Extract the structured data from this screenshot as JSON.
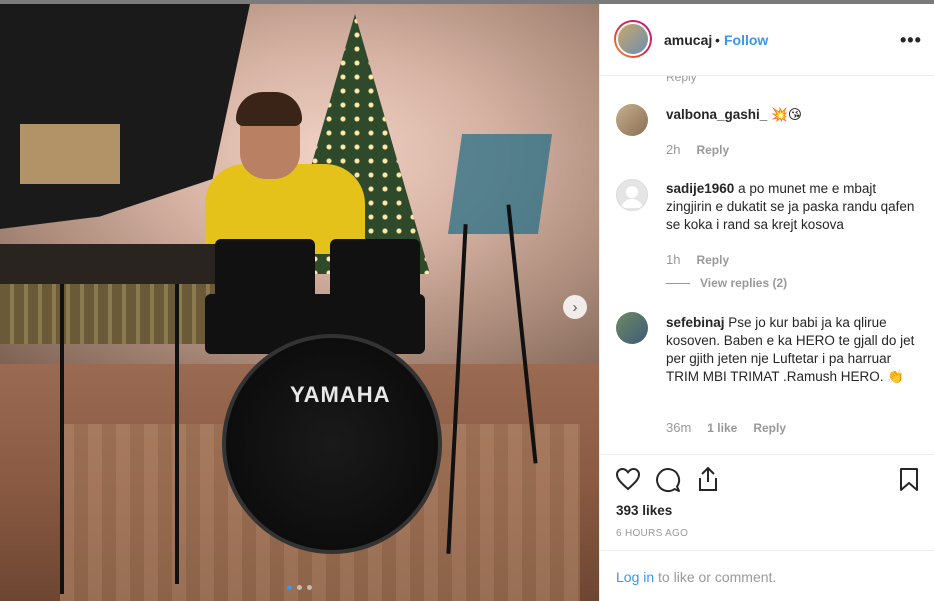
{
  "post": {
    "username": "amucaj",
    "separator": "•",
    "follow_label": "Follow",
    "more_label": "•••",
    "drum_brand": "YAMAHA",
    "next_arrow": "›",
    "carousel": {
      "count": 3,
      "active_index": 0
    }
  },
  "comments": [
    {
      "username": "valbona_gashi_",
      "text": " 💥😘",
      "time": "2h",
      "likes_label": "",
      "reply_label": "Reply"
    },
    {
      "username": "sadije1960",
      "text": " a po munet me e mbajt zingjirin e dukatit se ja paska randu qafen se koka i rand sa krejt kosova",
      "time": "1h",
      "likes_label": "",
      "reply_label": "Reply",
      "view_replies_label": "View replies (2)"
    },
    {
      "username": "sefebinaj",
      "text": " Pse jo kur babi ja ka qlirue kosoven. Baben e ka HERO te gjall do jet per gjith jeten nje Luftetar i pa harruar TRIM MBI TRIMAT .Ramush HERO. 👏",
      "time": "36m",
      "likes_label": "1 like",
      "reply_label": "Reply"
    }
  ],
  "cut_top_label": "Reply",
  "actions": {
    "like_icon": "heart-icon",
    "comment_icon": "comment-icon",
    "share_icon": "share-icon",
    "save_icon": "bookmark-icon",
    "likes_text": "393 likes",
    "time_ago": "6 HOURS AGO"
  },
  "login": {
    "link_text": "Log in",
    "rest_text": " to like or comment."
  },
  "colors": {
    "link_blue": "#3897f0",
    "text": "#262626",
    "muted": "#999999",
    "divider": "#efefef"
  }
}
